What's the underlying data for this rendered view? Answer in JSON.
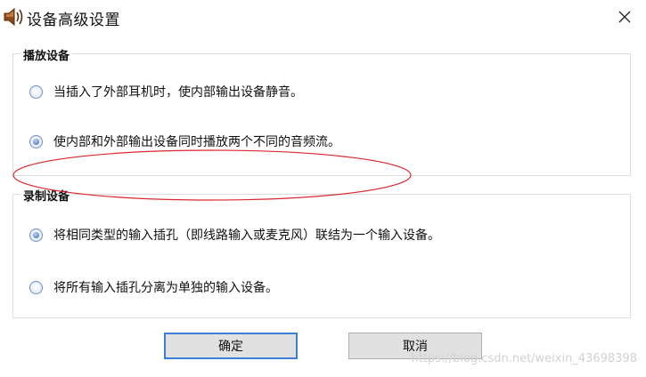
{
  "window": {
    "title": "设备高级设置"
  },
  "playback": {
    "legend": "播放设备",
    "options": [
      {
        "label": "当插入了外部耳机时，使内部输出设备静音。",
        "checked": false
      },
      {
        "label": "使内部和外部输出设备同时播放两个不同的音频流。",
        "checked": true
      }
    ]
  },
  "recording": {
    "legend": "录制设备",
    "options": [
      {
        "label": "将相同类型的输入插孔（即线路输入或麦克风）联结为一个输入设备。",
        "checked": true
      },
      {
        "label": "将所有输入插孔分离为单独的输入设备。",
        "checked": false
      }
    ]
  },
  "buttons": {
    "ok": "确定",
    "cancel": "取消"
  },
  "watermark": "https://blog.csdn.net/weixin_43698398",
  "colors": {
    "annotation": "#d9272e",
    "ok_border": "#3c7fd6"
  }
}
